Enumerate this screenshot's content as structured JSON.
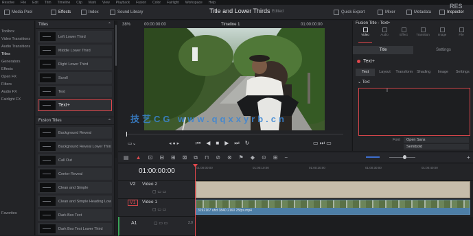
{
  "menubar": {
    "items": [
      "Resolve",
      "File",
      "Edit",
      "Trim",
      "Timeline",
      "Clip",
      "Mark",
      "View",
      "Playback",
      "Fusion",
      "Color",
      "Fairlight",
      "Workspace",
      "Help"
    ]
  },
  "toolbar": {
    "media_pool": "Media Pool",
    "effects": "Effects",
    "index": "Index",
    "sound_library": "Sound Library",
    "project_title": "Title and Lower Thirds",
    "project_status": "Edited",
    "quick_export": "Quick Export",
    "mixer": "Mixer",
    "metadata": "Metadata",
    "inspector": "Inspector",
    "brand": "RES"
  },
  "left_nav": {
    "items": [
      "Toolbox",
      "Video Transitions",
      "Audio Transitions",
      "Titles",
      "Generators",
      "Effects",
      "Open FX",
      "Filters",
      "Audio FX",
      "Fairlight FX"
    ],
    "selected_index": 3,
    "bottom": "Favorites"
  },
  "effects_panel": {
    "titles_header": "Titles",
    "fusion_header": "Fusion Titles",
    "titles": [
      "Left Lower Third",
      "Middle Lower Third",
      "Right Lower Third",
      "Scroll",
      "Text",
      "Text+"
    ],
    "selected_title_index": 5,
    "fusion_titles": [
      "Background Reveal",
      "Background Reveal Lower Third",
      "Call Out",
      "Center Reveal",
      "Clean and Simple",
      "Clean and Simple Heading Lower Third",
      "Dark Box Text",
      "Dark Box Text Lower Third"
    ]
  },
  "viewer": {
    "zoom": "38%",
    "source_timecode": "00:00:00:00",
    "timeline_name": "Timeline 1",
    "duration_timecode": "01:00:00:00",
    "timeline_timecode": "01:00:00:00"
  },
  "inspector": {
    "clip_title": "Fusion Title - Text+",
    "tabs": [
      "Video",
      "Audio",
      "Effect",
      "Transition",
      "Image",
      "File"
    ],
    "subtabs": [
      "Title",
      "Settings"
    ],
    "node": "Text+",
    "inner_tabs": [
      "Text",
      "Layout",
      "Transform",
      "Shading",
      "Image",
      "Settings"
    ],
    "section": "Text",
    "font_label": "Font",
    "font_value": "Open Sans",
    "style_value": "Semibold"
  },
  "timeline": {
    "timecode": "01:00:00:00",
    "ruler": [
      "01:00:00:00",
      "01:00:10:00",
      "01:00:20:00",
      "01:00:30:00",
      "01:00:40:00"
    ],
    "tracks": [
      {
        "id": "V2",
        "name": "Video 2"
      },
      {
        "id": "V1",
        "name": "Video 1"
      },
      {
        "id": "A1",
        "name": "",
        "level": "2.0"
      }
    ],
    "video_clip_name": "3192167 uhd 3840 2160 25fps.mp4"
  },
  "watermark": "技艺CG   www.qqxxyrb.cn"
}
